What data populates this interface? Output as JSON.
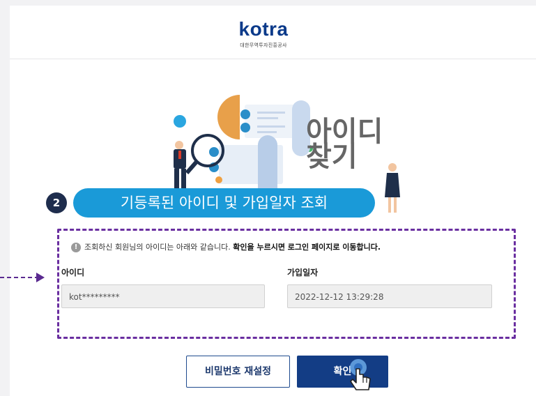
{
  "header": {
    "logo_text": "kotra",
    "logo_subtitle": "대한무역투자진흥공사"
  },
  "hero": {
    "title_line1": "아이디",
    "title_line2": "찾기"
  },
  "step": {
    "number": "2",
    "label": "기등록된 아이디 및 가입일자 조회"
  },
  "notice": {
    "icon": "!",
    "text": "조회하신 회원님의 아이디는 아래와 같습니다.",
    "bold_text": "확인을 누르시면 로그인 페이지로 이동합니다."
  },
  "fields": {
    "id_label": "아이디",
    "id_value": "kot*********",
    "date_label": "가입일자",
    "date_value": "2022-12-12  13:29:28"
  },
  "buttons": {
    "reset_password": "비밀번호 재설정",
    "confirm": "확인"
  },
  "colors": {
    "brand_blue": "#133d85",
    "step_pill": "#1a9ad8",
    "highlight_border": "#6a2fa0"
  }
}
